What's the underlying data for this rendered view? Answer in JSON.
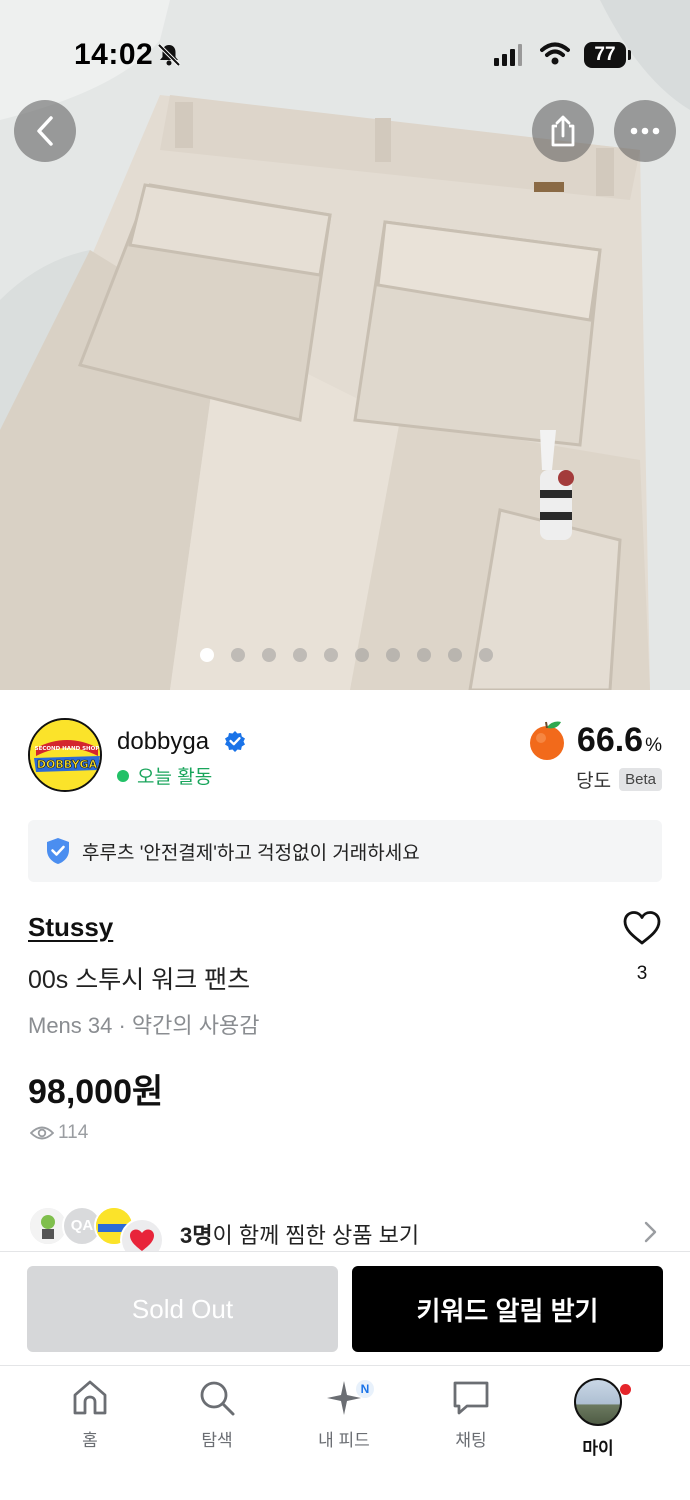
{
  "status_bar": {
    "time": "14:02",
    "battery": "77"
  },
  "gallery": {
    "total_images": 10,
    "current_index": 1
  },
  "seller": {
    "name": "dobbyga",
    "activity": "오늘 활동",
    "score_value": "66.6",
    "score_unit": "%",
    "score_label": "당도",
    "beta_label": "Beta",
    "avatar_text_top": "SECOND HAND SHOP",
    "avatar_text_main": "DOBBYGA"
  },
  "notice": {
    "text": "후루츠 '안전결제'하고 걱정없이 거래하세요"
  },
  "product": {
    "brand": "Stussy",
    "name": "00s 스투시 워크 팬츠",
    "meta": "Mens 34 · 약간의 사용감",
    "price": "98,000원",
    "views": "114",
    "likes": "3"
  },
  "together": {
    "count": "3명",
    "text": "이 함께 찜한 상품 보기",
    "avatar_label": "QA"
  },
  "actions": {
    "sold_out": "Sold Out",
    "keyword_alert": "키워드 알림 받기"
  },
  "tabs": [
    {
      "label": "홈",
      "icon": "home-icon"
    },
    {
      "label": "탐색",
      "icon": "search-icon"
    },
    {
      "label": "내 피드",
      "icon": "sparkle-icon",
      "badge": "N"
    },
    {
      "label": "채팅",
      "icon": "chat-icon"
    },
    {
      "label": "마이",
      "icon": "profile-avatar"
    }
  ],
  "colors": {
    "online": "#22c167",
    "verified": "#1a73e8",
    "accent_black": "#000000",
    "disabled": "#d6d7d9"
  }
}
